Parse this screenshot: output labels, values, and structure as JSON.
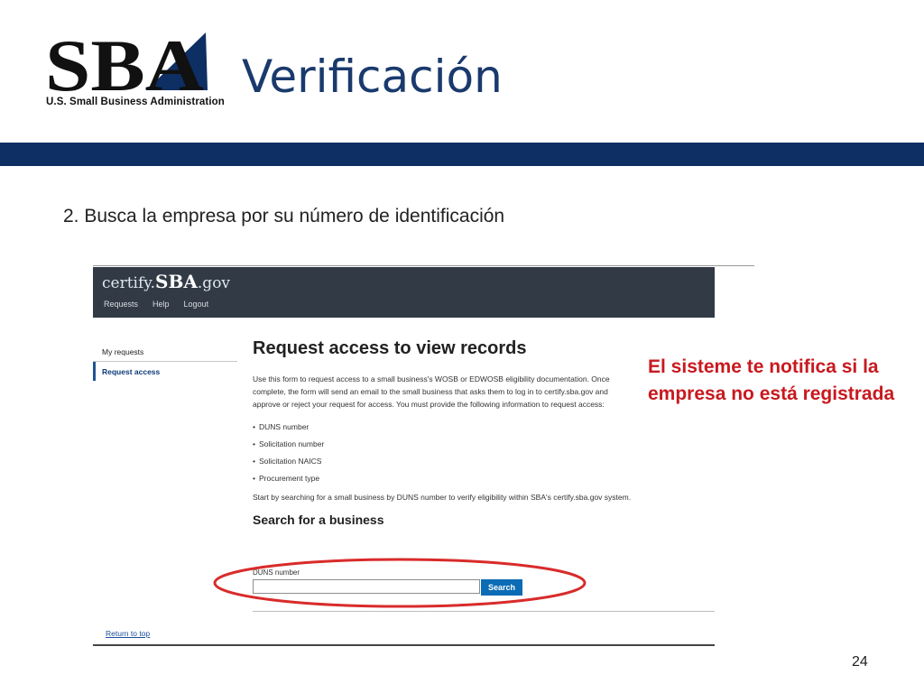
{
  "logo": {
    "wordmark": "SBA",
    "tagline": "U.S. Small Business Administration"
  },
  "slide": {
    "title": "Verificación",
    "subtitle": "2. Busca la empresa por su número de identificación",
    "note": "El sisteme te notifica si la empresa no está registrada",
    "page_number": "24",
    "colors": {
      "title": "#1a3a6d",
      "bar": "#0e2f63",
      "note": "#c8191f",
      "ellipse": "#d92b2b"
    }
  },
  "site": {
    "logo_prefix": "certify.",
    "logo_main": "SBA",
    "logo_suffix": ".gov",
    "nav": [
      "Requests",
      "Help",
      "Logout"
    ],
    "side_nav": {
      "my_requests": "My requests",
      "request_access": "Request access"
    },
    "heading": "Request access to view records",
    "intro": "Use this form to request access to a small business's WOSB or EDWOSB eligibility documentation. Once complete, the form will send an email to the small business that asks them to log in to certify.sba.gov and approve or reject your request for access. You must provide the following information to request access:",
    "requirements": [
      "DUNS number",
      "Solicitation number",
      "Solicitation NAICS",
      "Procurement type"
    ],
    "start_text": "Start by searching for a small business by DUNS number to verify eligibility within SBA's certify.sba.gov system.",
    "search_heading": "Search for a business",
    "duns_label": "DUNS number",
    "duns_value": "",
    "search_button": "Search",
    "return_to_top": "Return to top",
    "colors": {
      "header": "#323a45",
      "button": "#0b6bb5",
      "link": "#1a4f99"
    }
  }
}
